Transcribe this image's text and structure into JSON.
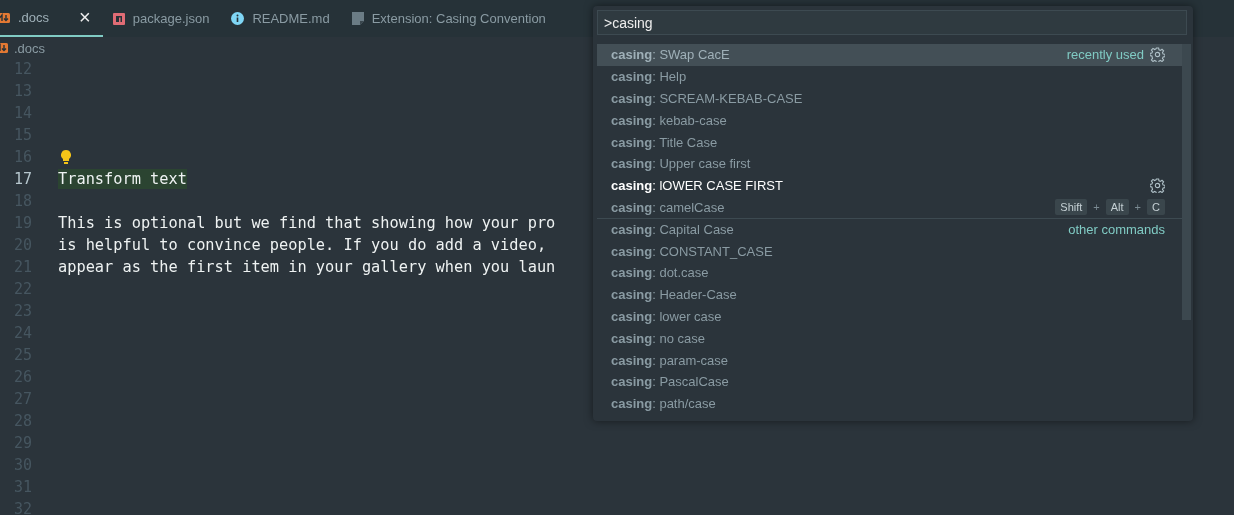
{
  "tabs": [
    {
      "label": ".docs",
      "kind": "markdown",
      "selected": true,
      "close": "×"
    },
    {
      "label": "package.json",
      "kind": "package",
      "selected": false
    },
    {
      "label": "README.md",
      "kind": "info",
      "selected": false
    },
    {
      "label": "Extension: Casing Convention",
      "kind": "document",
      "selected": false
    }
  ],
  "breadcrumb": {
    "kind": "markdown",
    "label": ".docs"
  },
  "editor": {
    "lines": [
      {
        "number": "12",
        "kind": "text",
        "current": false
      },
      {
        "number": "13",
        "kind": "text",
        "current": false
      },
      {
        "number": "14",
        "kind": "text",
        "current": false
      },
      {
        "number": "15",
        "kind": "text",
        "current": false
      },
      {
        "number": "16",
        "kind": "bulb",
        "current": false
      },
      {
        "number": "17",
        "kind": "highlight",
        "text": "Transform text",
        "current": true
      },
      {
        "number": "18",
        "kind": "text",
        "current": false
      },
      {
        "number": "19",
        "kind": "text",
        "text": "This is optional but we find that showing how your pro",
        "current": false
      },
      {
        "number": "20",
        "kind": "text",
        "text": "is helpful to convince people. If you do add a video,",
        "current": false
      },
      {
        "number": "21",
        "kind": "text",
        "text": "appear as the first item in your gallery when you laun",
        "current": false
      },
      {
        "number": "22",
        "kind": "text",
        "current": false
      },
      {
        "number": "23",
        "kind": "text",
        "current": false
      },
      {
        "number": "24",
        "kind": "text",
        "current": false
      },
      {
        "number": "25",
        "kind": "text",
        "current": false
      },
      {
        "number": "26",
        "kind": "text",
        "current": false
      },
      {
        "number": "27",
        "kind": "text",
        "current": false
      },
      {
        "number": "28",
        "kind": "text",
        "current": false
      },
      {
        "number": "29",
        "kind": "text",
        "current": false
      },
      {
        "number": "30",
        "kind": "text",
        "current": false
      },
      {
        "number": "31",
        "kind": "text",
        "current": false
      },
      {
        "number": "32",
        "kind": "text",
        "current": false
      }
    ]
  },
  "command_palette": {
    "query": ">casing",
    "items": [
      {
        "label": "**casing**: SWap CacE",
        "selected": true,
        "hovered": false,
        "group": "recently used"
      },
      {
        "label": "**casing**: Help",
        "selected": false,
        "hovered": false
      },
      {
        "label": "**casing**: SCREAM-KEBAB-CASE",
        "selected": false,
        "hovered": false
      },
      {
        "label": "**casing**: kebab-case",
        "selected": false,
        "hovered": false
      },
      {
        "label": "**casing**: Title Case",
        "selected": false,
        "hovered": false
      },
      {
        "label": "**casing**: Upper case first",
        "selected": false,
        "hovered": false
      },
      {
        "label": "**casing**: lOWER CASE FIRST",
        "selected": false,
        "hovered": true
      },
      {
        "label": "**casing**: camelCase",
        "selected": false,
        "hovered": false,
        "keybinding": [
          "Shift",
          "Alt",
          "C"
        ],
        "separator": "+"
      },
      {
        "label": "**casing**: Capital Case",
        "selected": false,
        "hovered": false,
        "group": "other commands"
      },
      {
        "label": "**casing**: CONSTANT_CASE",
        "selected": false,
        "hovered": false
      },
      {
        "label": "**casing**: dot.case",
        "selected": false,
        "hovered": false
      },
      {
        "label": "**casing**: Header-Case",
        "selected": false,
        "hovered": false
      },
      {
        "label": "**casing**: lower case",
        "selected": false,
        "hovered": false
      },
      {
        "label": "**casing**: no case",
        "selected": false,
        "hovered": false
      },
      {
        "label": "**casing**: param-case",
        "selected": false,
        "hovered": false
      },
      {
        "label": "**casing**: PascalCase",
        "selected": false,
        "hovered": false
      },
      {
        "label": "**casing**: path/case",
        "selected": false,
        "hovered": false
      }
    ]
  }
}
